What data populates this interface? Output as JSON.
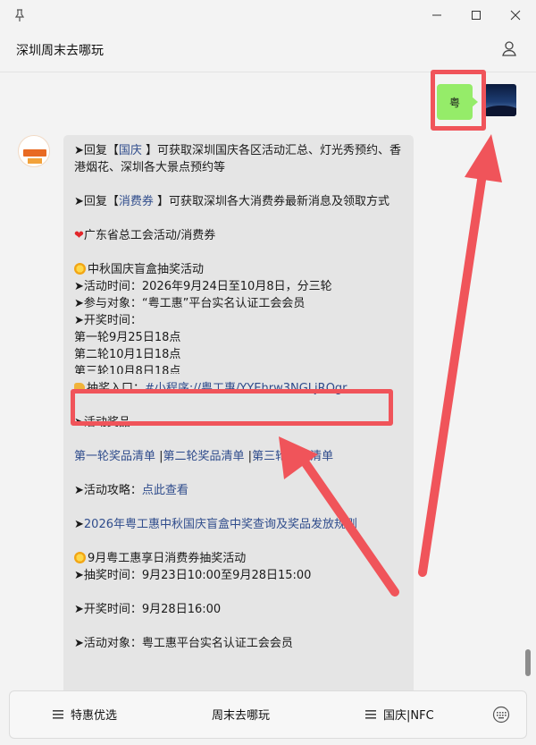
{
  "window": {
    "title": "深圳周末去哪玩"
  },
  "outgoing": {
    "text": "粤"
  },
  "message": {
    "line1": {
      "prefix": "➤回复【",
      "keyword": "国庆",
      "suffix": " 】可获取深圳国庆各区活动汇总、灯光秀预约、香港烟花、深圳各大景点预约等"
    },
    "line2": {
      "prefix": "➤回复【",
      "keyword": "消费券",
      "suffix": " 】可获取深圳各大消费券最新消息及领取方式"
    },
    "union_title": "广东省总工会活动/消费券",
    "event1_title": "中秋国庆盲盒抽奖活动",
    "event1_time": "➤活动时间：2026年9月24日至10月8日，分三轮",
    "event1_target": "➤参与对象：“粤工惠”平台实名认证工会会员",
    "event1_draw_label": "➤开奖时间：",
    "draw1": "第一轮9月25日18点",
    "draw2": "第二轮10月1日18点",
    "draw3": "第三轮10月8日18点",
    "entry_label": "抽奖入口：",
    "entry_link": "#小程序://粤工惠/YYEhrw3NGLjROgr",
    "prizes_label": "➤活动奖品",
    "prize_link1": "第一轮奖品清单",
    "prize_sep": " |",
    "prize_link2": "第二轮奖品清单",
    "prize_sep2": " |",
    "prize_link3": "第三轮奖品清单",
    "guide_label": "➤活动攻略：",
    "guide_link": "点此查看",
    "rules_arrow": "➤",
    "rules_link": "2026年粤工惠中秋国庆盲盒中奖查询及奖品发放规则",
    "event2_title": "9月粤工惠享日消费券抽奖活动",
    "event2_time": "➤抽奖时间：9月23日10:00至9月28日15:00",
    "event2_draw": "➤开奖时间：9月28日16:00",
    "event2_target": "➤活动对象：粤工惠平台实名认证工会会员"
  },
  "menu": {
    "item1": "特惠优选",
    "item2": "周末去哪玩",
    "item3": "国庆|NFC"
  },
  "colors": {
    "accent_green": "#95ec69",
    "highlight_red": "#f0545a",
    "link_blue": "#2f4c8c"
  }
}
